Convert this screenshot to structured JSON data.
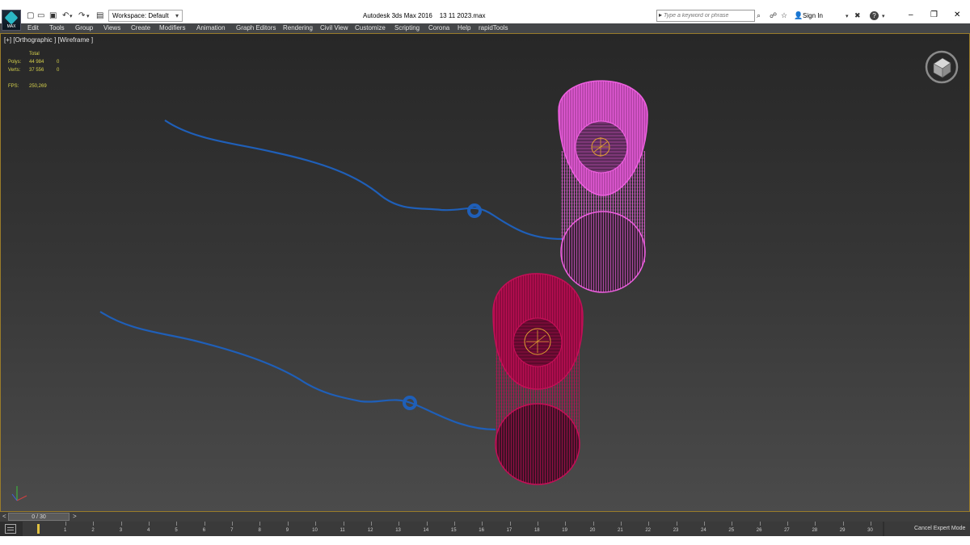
{
  "titlebar": {
    "logo_label": "MAX",
    "workspace": "Workspace: Default",
    "app_title": "Autodesk 3ds Max 2016",
    "file_name": "13 11 2023.max",
    "search_placeholder": "Type a keyword or phrase",
    "sign_in": "Sign In"
  },
  "menu": [
    "Edit",
    "Tools",
    "Group",
    "Views",
    "Create",
    "Modifiers",
    "Animation",
    "Graph Editors",
    "Rendering",
    "Civil View",
    "Customize",
    "Scripting",
    "Corona",
    "Help",
    "rapidTools"
  ],
  "viewport": {
    "label": "[+] [Orthographic ] [Wireframe ]",
    "stats": {
      "total_label": "Total",
      "polys_label": "Polys:",
      "polys_value": "44 984",
      "polys_sel": "0",
      "verts_label": "Verts:",
      "verts_value": "37 556",
      "verts_sel": "0",
      "fps_label": "FPS:",
      "fps_value": "250,269"
    }
  },
  "timeslider": {
    "left_arrow": "<",
    "frame": "0 / 30",
    "right_arrow": ">"
  },
  "trackbar": {
    "ticks": [
      "1",
      "2",
      "3",
      "4",
      "5",
      "6",
      "7",
      "8",
      "9",
      "10",
      "11",
      "12",
      "13",
      "14",
      "15",
      "16",
      "17",
      "18",
      "19",
      "20",
      "21",
      "22",
      "23",
      "24",
      "25",
      "26",
      "27",
      "28",
      "29",
      "30"
    ]
  },
  "status": {
    "cancel_expert": "Cancel Expert Mode"
  },
  "colors": {
    "viewport_border": "#9a7c2a",
    "stats_text": "#d7d24c",
    "spline_blue": "#1f5fb8",
    "object_magenta": "#ee5fe0",
    "object_crimson": "#c40e57",
    "pivot_orange": "#e0a030"
  }
}
